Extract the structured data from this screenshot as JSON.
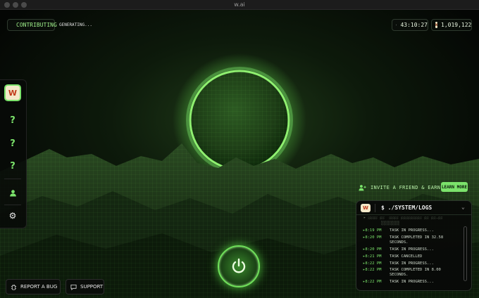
{
  "window": {
    "title": "w.ai"
  },
  "status": {
    "contributing_label": "CONTRIBUTING",
    "activity_text": "GENERATING..."
  },
  "header": {
    "uptime": "43:10:27",
    "points": "1,019,122"
  },
  "sidebar": {
    "items": [
      {
        "name": "app-logo",
        "icon": "w-logo-icon"
      },
      {
        "name": "unknown-1",
        "icon": "question-icon",
        "label": "?"
      },
      {
        "name": "unknown-2",
        "icon": "question-icon",
        "label": "?"
      },
      {
        "name": "unknown-3",
        "icon": "question-icon",
        "label": "?"
      },
      {
        "name": "profile",
        "icon": "user-icon"
      },
      {
        "name": "settings",
        "icon": "gear-icon"
      }
    ]
  },
  "invite": {
    "label": "INVITE A FRIEND & EARN",
    "button_label": "LEARN MORE"
  },
  "logs": {
    "title": "$ ./SYSTEM/LOGS",
    "rows": [
      {
        "time": "8:19 PM",
        "message": "TASK IN PROGRESS..."
      },
      {
        "time": "8:20 PM",
        "message": "TASK COMPLETED IN 32.58 SECONDS."
      },
      {
        "time": "8:20 PM",
        "message": "TASK IN PROGRESS..."
      },
      {
        "time": "8:21 PM",
        "message": "TASK CANCELLED"
      },
      {
        "time": "8:22 PM",
        "message": "TASK IN PROGRESS..."
      },
      {
        "time": "8:22 PM",
        "message": "TASK COMPLETED IN 8.00 SECONDS."
      },
      {
        "time": "8:22 PM",
        "message": "TASK IN PROGRESS..."
      }
    ]
  },
  "footer": {
    "report_bug_label": "REPORT A BUG",
    "support_label": "SUPPORT"
  },
  "colors": {
    "accent": "#7be36b",
    "background": "#050805"
  }
}
